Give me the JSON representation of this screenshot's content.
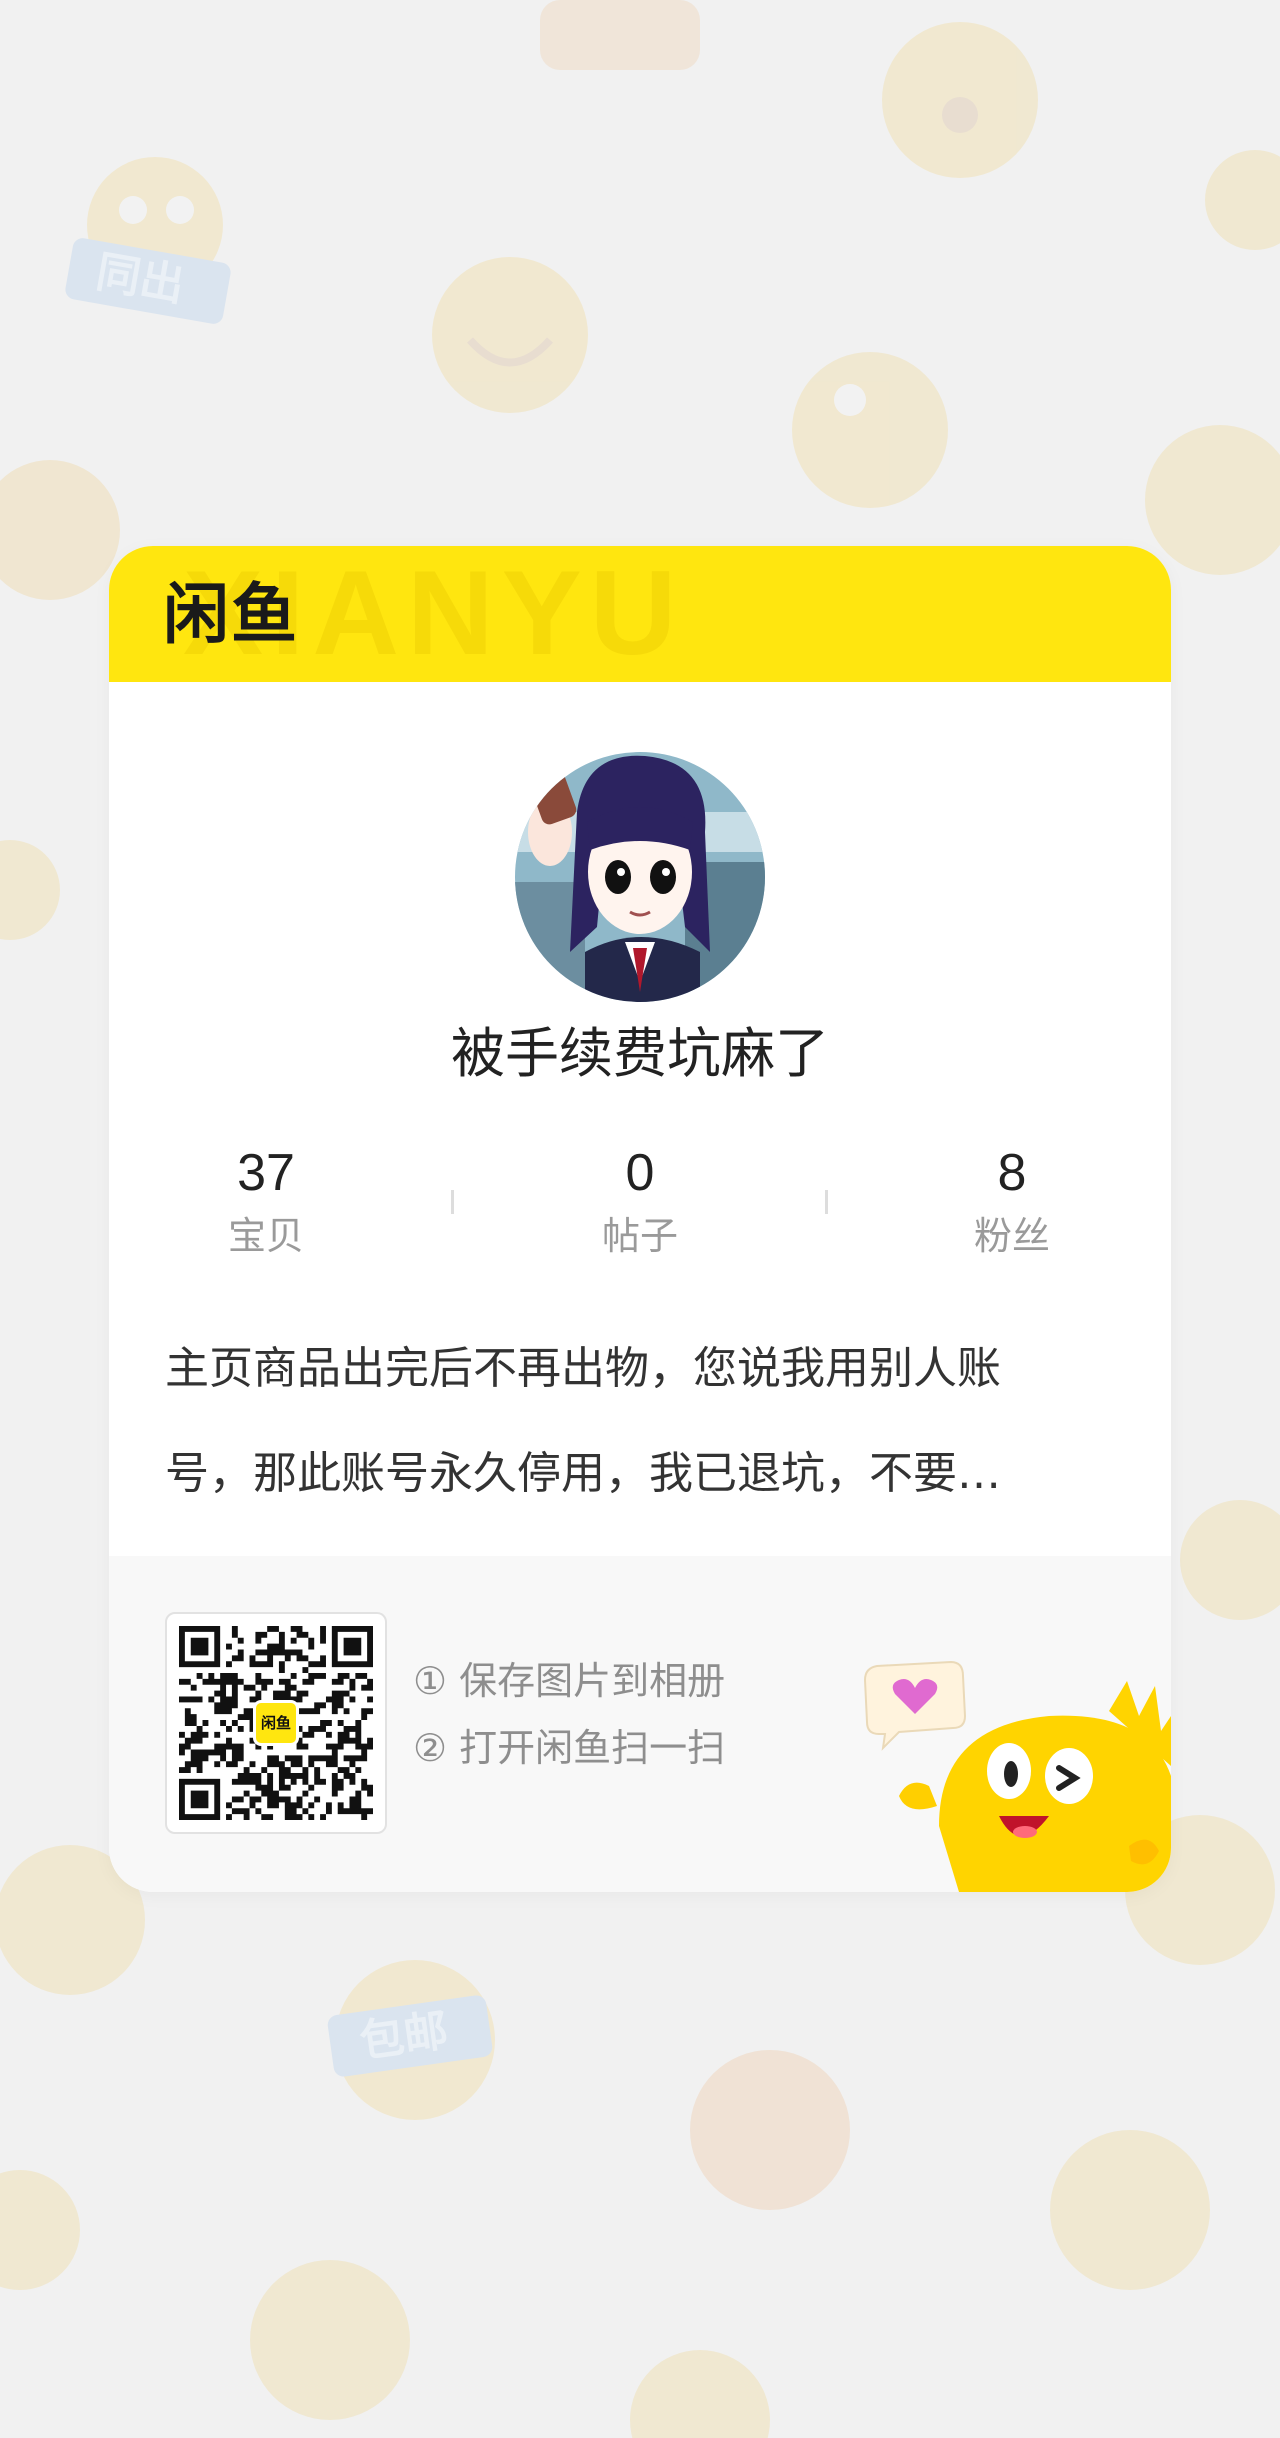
{
  "brand": {
    "logo_text": "闲鱼",
    "watermark": "XIANYU"
  },
  "profile": {
    "nickname": "被手续费坑麻了",
    "avatar": "avatar-anime-girl"
  },
  "stats": [
    {
      "value": "37",
      "label": "宝贝"
    },
    {
      "value": "0",
      "label": "帖子"
    },
    {
      "value": "8",
      "label": "粉丝"
    }
  ],
  "bio": {
    "line1": "主页商品出完后不再出物，您说我用别人账",
    "line2": "号，那此账号永久停用，我已退坑，不要…"
  },
  "share": {
    "qr_logo": "闲鱼",
    "step1": "① 保存图片到相册",
    "step2": "② 打开闲鱼扫一扫"
  },
  "background": {
    "sticker_tags": [
      "同出",
      "包邮"
    ]
  },
  "colors": {
    "brand_yellow": "#ffe60f",
    "page_bg": "#f1f1f1",
    "text_primary": "#222222",
    "text_secondary": "#9a9a9a"
  }
}
